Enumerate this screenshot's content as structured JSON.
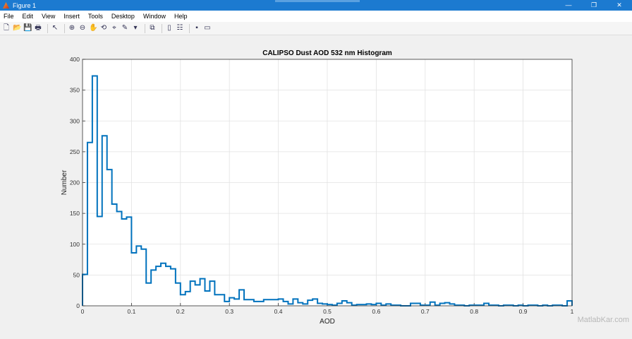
{
  "window": {
    "title": "Figure 1",
    "minimize": "—",
    "maximize": "❐",
    "close": "✕"
  },
  "menu": [
    "File",
    "Edit",
    "View",
    "Insert",
    "Tools",
    "Desktop",
    "Window",
    "Help"
  ],
  "toolbar": [
    {
      "name": "new-figure-icon",
      "glyph": "🗋"
    },
    {
      "name": "open-icon",
      "glyph": "📂"
    },
    {
      "name": "save-icon",
      "glyph": "💾"
    },
    {
      "name": "print-icon",
      "glyph": "🖶"
    },
    {
      "sep": true
    },
    {
      "name": "pointer-icon",
      "glyph": "↖"
    },
    {
      "sep": true
    },
    {
      "name": "zoom-in-icon",
      "glyph": "⊕"
    },
    {
      "name": "zoom-out-icon",
      "glyph": "⊖"
    },
    {
      "name": "pan-icon",
      "glyph": "✋"
    },
    {
      "name": "rotate-icon",
      "glyph": "⟲"
    },
    {
      "name": "data-cursor-icon",
      "glyph": "⌖"
    },
    {
      "name": "brush-icon",
      "glyph": "✎"
    },
    {
      "name": "brush-dropdown-icon",
      "glyph": "▾"
    },
    {
      "sep": true
    },
    {
      "name": "link-plot-icon",
      "glyph": "⧉"
    },
    {
      "sep": true
    },
    {
      "name": "colorbar-icon",
      "glyph": "▯"
    },
    {
      "name": "legend-icon",
      "glyph": "☷"
    },
    {
      "sep": true
    },
    {
      "name": "hide-plot-tools-icon",
      "glyph": "▪"
    },
    {
      "name": "show-plot-tools-icon",
      "glyph": "▭"
    }
  ],
  "watermark": "MatlabKar.com",
  "colors": {
    "line": "#0072bd",
    "grid": "#e2e2e2",
    "titlebar": "#1c7ad0"
  },
  "chart_data": {
    "type": "histogram-stairs",
    "title": "CALIPSO Dust AOD 532 nm Histogram",
    "xlabel": "AOD",
    "ylabel": "Number",
    "xlim": [
      0,
      1
    ],
    "ylim": [
      0,
      400
    ],
    "grid": true,
    "xticks": [
      "0",
      "0.1",
      "0.2",
      "0.3",
      "0.4",
      "0.5",
      "0.6",
      "0.7",
      "0.8",
      "0.9",
      "1"
    ],
    "yticks": [
      "0",
      "50",
      "100",
      "150",
      "200",
      "250",
      "300",
      "350",
      "400"
    ],
    "bin_width": 0.01,
    "values": [
      51,
      265,
      373,
      145,
      276,
      221,
      165,
      153,
      141,
      144,
      86,
      97,
      92,
      37,
      58,
      64,
      69,
      64,
      60,
      37,
      18,
      23,
      40,
      34,
      44,
      24,
      40,
      18,
      18,
      7,
      13,
      11,
      26,
      10,
      10,
      7,
      7,
      10,
      10,
      10,
      11,
      7,
      3,
      11,
      5,
      3,
      9,
      11,
      4,
      3,
      2,
      1,
      4,
      8,
      5,
      1,
      2,
      2,
      3,
      2,
      4,
      1,
      3,
      1,
      1,
      0,
      0,
      4,
      4,
      1,
      1,
      6,
      1,
      4,
      5,
      3,
      1,
      1,
      0,
      1,
      1,
      1,
      4,
      1,
      1,
      0,
      1,
      1,
      0,
      1,
      0,
      1,
      1,
      0,
      1,
      0,
      1,
      1,
      0,
      8
    ]
  }
}
